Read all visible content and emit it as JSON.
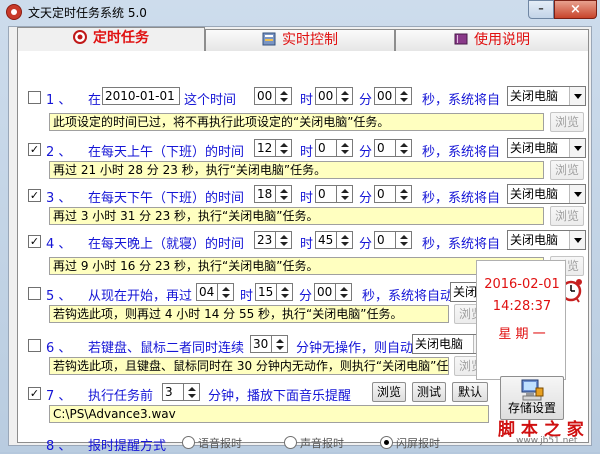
{
  "window": {
    "title": "文天定时任务系统 5.0",
    "minimize": "–",
    "close": "×"
  },
  "tabs": {
    "timer": "定时任务",
    "realtime": "实时控制",
    "help": "使用说明"
  },
  "tasks": {
    "t1": {
      "checked": "",
      "num": "1 、",
      "text1": "在",
      "date": "2010-01-01",
      "text2": "这个时间",
      "hour": "00",
      "hlbl": "时",
      "minute": "00",
      "mlbl": "分",
      "second": "00",
      "text3": "秒，系统将自",
      "action": "关闭电脑",
      "status": "此项设定的时间已过，将不再执行此项设定的“关闭电脑”任务。",
      "browse": "浏览"
    },
    "t2": {
      "checked": "✓",
      "num": "2 、",
      "text1": "在每天上午（下班）的时间",
      "hour": "12",
      "hlbl": "时",
      "minute": "0",
      "mlbl": "分",
      "second": "0",
      "text3": "秒，系统将自",
      "action": "关闭电脑",
      "status": "再过 21 小时 28 分 23 秒，执行“关闭电脑”任务。",
      "browse": "浏览"
    },
    "t3": {
      "checked": "✓",
      "num": "3 、",
      "text1": "在每天下午（下班）的时间",
      "hour": "18",
      "hlbl": "时",
      "minute": "0",
      "mlbl": "分",
      "second": "0",
      "text3": "秒，系统将自",
      "action": "关闭电脑",
      "status": "再过 3 小时 31 分 23 秒，执行“关闭电脑”任务。",
      "browse": "浏览"
    },
    "t4": {
      "checked": "✓",
      "num": "4 、",
      "text1": "在每天晚上（就寝）的时间",
      "hour": "23",
      "hlbl": "时",
      "minute": "45",
      "mlbl": "分",
      "second": "0",
      "text3": "秒，系统将自",
      "action": "关闭电脑",
      "status": "再过 9 小时 16 分 23 秒，执行“关闭电脑”任务。",
      "browse": "浏览"
    },
    "t5": {
      "checked": "",
      "num": "5 、",
      "text1": "从现在开始，再过",
      "hour": "04",
      "hlbl": "时",
      "minute": "15",
      "mlbl": "分",
      "second": "00",
      "text3": "秒，系统将自动",
      "action": "关闭电脑",
      "status": "若钩选此项，则再过 4 小时 14 分 55 秒，执行“关闭电脑”任务。",
      "browse": "浏览"
    },
    "t6": {
      "checked": "",
      "num": "6 、",
      "text1": "若键盘、鼠标二者同时连续",
      "minutes": "30",
      "text2": "分钟无操作，则自动",
      "action": "关闭电脑",
      "status": "若钩选此项，且键盘、鼠标同时在 30 分钟内无动作，则执行“关闭电脑”任务。",
      "browse": "浏览"
    },
    "t7": {
      "checked": "✓",
      "num": "7 、",
      "text1": "执行任务前",
      "minutes": "3",
      "text2": "分钟，播放下面音乐提醒",
      "path": "C:\\PS\\Advance3.wav",
      "browse": "浏览",
      "test": "测试",
      "default": "默认"
    },
    "t8": {
      "num": "8 、",
      "text1": "报时提醒方式",
      "opt1": "语音报时",
      "opt2": "声音报时",
      "opt3": "闪屏报时",
      "selected": "3"
    }
  },
  "clock": {
    "date": "2016-02-01",
    "time": "14:28:37",
    "weekday": "星 期 一"
  },
  "save": {
    "label": "存储设置"
  },
  "watermark": {
    "line1": "脚 本 之 家",
    "line2": "www.jb51.net"
  },
  "colors": {
    "accent_red": "#e01010",
    "label_blue": "#1515d6",
    "status_bg": "#ffffc0"
  }
}
